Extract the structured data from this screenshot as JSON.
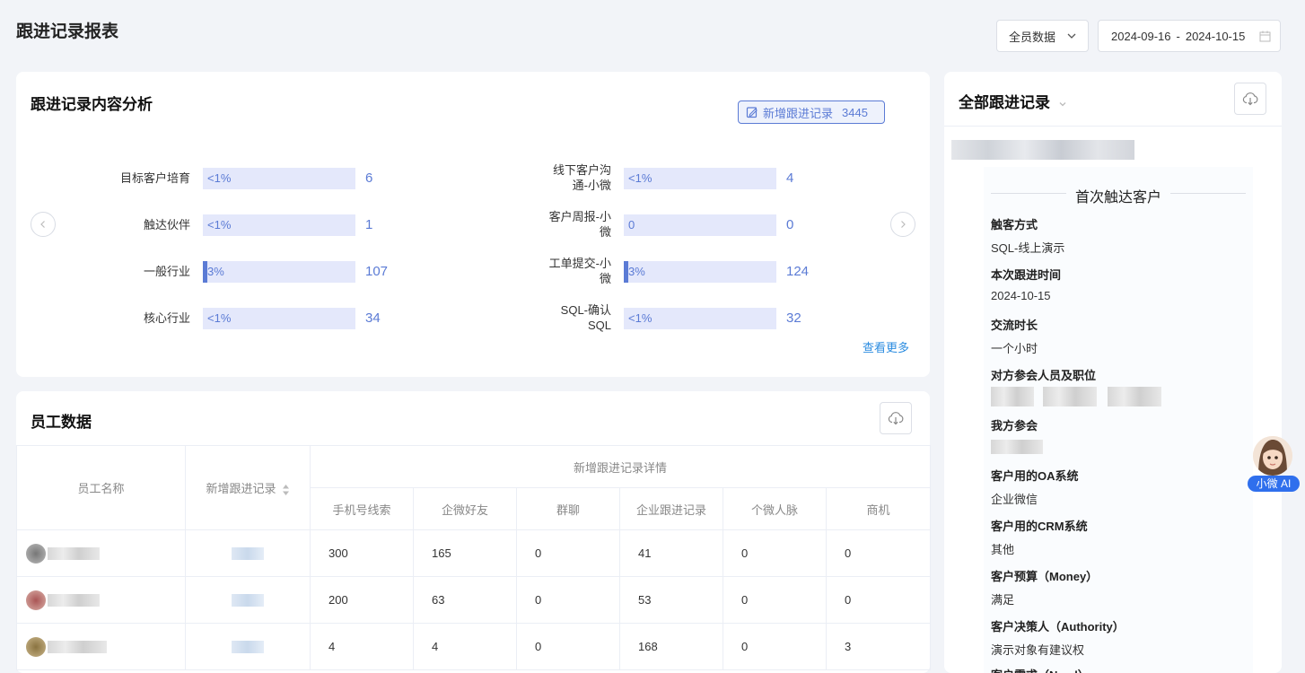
{
  "page": {
    "title": "跟进记录报表"
  },
  "filters": {
    "scope": "全员数据",
    "date_start": "2024-09-16",
    "date_sep": "-",
    "date_end": "2024-10-15"
  },
  "analysis": {
    "title": "跟进记录内容分析",
    "badge_label": "新增跟进记录",
    "badge_count": "3445",
    "view_more": "查看更多",
    "left": [
      {
        "label": "目标客户培育",
        "percent_text": "<1%",
        "fill": 0.3,
        "value": "6"
      },
      {
        "label": "触达伙伴",
        "percent_text": "<1%",
        "fill": 0.05,
        "value": "1"
      },
      {
        "label": "一般行业",
        "percent_text": "3%",
        "fill": 3,
        "value": "107"
      },
      {
        "label": "核心行业",
        "percent_text": "<1%",
        "fill": 0.9,
        "value": "34"
      }
    ],
    "right": [
      {
        "label": "线下客户沟通-小微",
        "percent_text": "<1%",
        "fill": 0.2,
        "value": "4"
      },
      {
        "label": "客户周报-小微",
        "percent_text": "0",
        "fill": 0,
        "value": "0"
      },
      {
        "label": "工单提交-小微",
        "percent_text": "3%",
        "fill": 3,
        "value": "124"
      },
      {
        "label": "SQL-确认SQL",
        "percent_text": "<1%",
        "fill": 0.9,
        "value": "32"
      }
    ]
  },
  "staff": {
    "title": "员工数据",
    "col_name": "员工名称",
    "col_new": "新增跟进记录",
    "group_header": "新增跟进记录详情",
    "sub_cols": [
      "手机号线索",
      "企微好友",
      "群聊",
      "企业跟进记录",
      "个微人脉",
      "商机"
    ],
    "rows": [
      {
        "values": [
          "300",
          "165",
          "0",
          "41",
          "0",
          "0"
        ]
      },
      {
        "values": [
          "200",
          "63",
          "0",
          "53",
          "0",
          "0"
        ]
      },
      {
        "values": [
          "4",
          "4",
          "0",
          "168",
          "0",
          "3"
        ]
      }
    ]
  },
  "records": {
    "title": "全部跟进记录",
    "section": "首次触达客户",
    "fields": [
      {
        "label": "触客方式",
        "value": "SQL-线上演示"
      },
      {
        "label": "本次跟进时间",
        "value": "2024-10-15"
      },
      {
        "label": "交流时长",
        "value": "一个小时"
      },
      {
        "label": "对方参会人员及职位",
        "value": ""
      },
      {
        "label": "我方参会",
        "value": ""
      },
      {
        "label": "客户用的OA系统",
        "value": "企业微信"
      },
      {
        "label": "客户用的CRM系统",
        "value": "其他"
      },
      {
        "label": "客户预算（Money）",
        "value": "满足"
      },
      {
        "label": "客户决策人（Authority）",
        "value": "演示对象有建议权"
      },
      {
        "label": "客户需求（Need）",
        "value": ""
      }
    ]
  },
  "assistant": {
    "label": "小微 AI"
  }
}
